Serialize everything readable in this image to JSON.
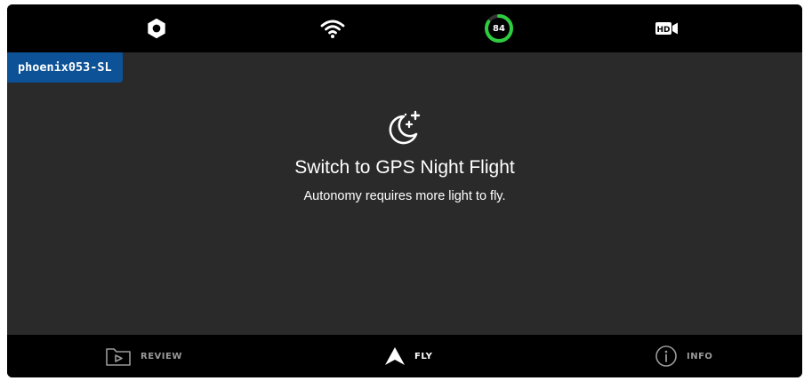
{
  "topbar": {
    "settings_icon": "gear-icon",
    "wifi_icon": "wifi-icon",
    "battery": {
      "level": 84,
      "label": "84",
      "color": "#2ecc40"
    },
    "video_icon": "hd-video-icon"
  },
  "device": {
    "name": "phoenix053-SL",
    "color": "#0d5296"
  },
  "message": {
    "icon": "moon-stars-icon",
    "title": "Switch to GPS Night Flight",
    "subtitle": "Autonomy requires more light to fly."
  },
  "tabs": [
    {
      "label": "REVIEW",
      "icon": "play-folder-icon",
      "active": false
    },
    {
      "label": "FLY",
      "icon": "navigation-arrow-icon",
      "active": true
    },
    {
      "label": "INFO",
      "icon": "info-icon",
      "active": false
    }
  ]
}
